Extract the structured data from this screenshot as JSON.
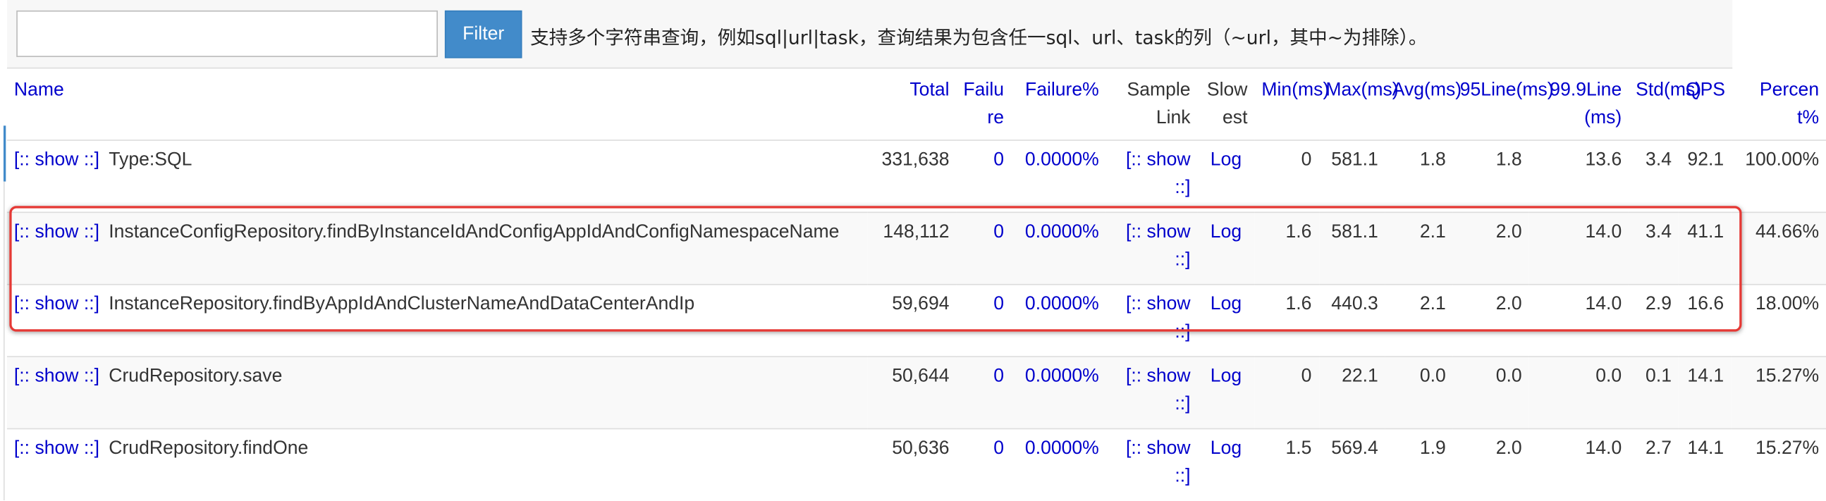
{
  "filter": {
    "input_value": "",
    "placeholder": "",
    "button_label": "Filter",
    "hint": "支持多个字符串查询，例如sql|url|task，查询结果为包含任一sql、url、task的列（~url，其中~为排除）。"
  },
  "headers": {
    "name": "Name",
    "total": "Total",
    "failure": "Failure",
    "failure_pct": "Failure%",
    "sample_link": "Sample Link",
    "slowest": "Slowest",
    "min": "Min(ms)",
    "max": "Max(ms)",
    "avg": "Avg(ms)",
    "line95": "95Line(ms)",
    "line999": "99.9Line(ms)",
    "std": "Std(ms)",
    "qps": "QPS",
    "percent": "Percent%"
  },
  "show_label": "[:: show ::]",
  "log_label": "Log",
  "rows": [
    {
      "name": "Type:SQL",
      "total": "331,638",
      "failure": "0",
      "failure_pct": "0.0000%",
      "min": "0",
      "max": "581.1",
      "avg": "1.8",
      "line95": "1.8",
      "line999": "13.6",
      "std": "3.4",
      "qps": "92.1",
      "percent": "100.00%"
    },
    {
      "name": "InstanceConfigRepository.findByInstanceIdAndConfigAppIdAndConfigNamespaceName",
      "total": "148,112",
      "failure": "0",
      "failure_pct": "0.0000%",
      "min": "1.6",
      "max": "581.1",
      "avg": "2.1",
      "line95": "2.0",
      "line999": "14.0",
      "std": "3.4",
      "qps": "41.1",
      "percent": "44.66%"
    },
    {
      "name": "InstanceRepository.findByAppIdAndClusterNameAndDataCenterAndIp",
      "total": "59,694",
      "failure": "0",
      "failure_pct": "0.0000%",
      "min": "1.6",
      "max": "440.3",
      "avg": "2.1",
      "line95": "2.0",
      "line999": "14.0",
      "std": "2.9",
      "qps": "16.6",
      "percent": "18.00%"
    },
    {
      "name": "CrudRepository.save",
      "total": "50,644",
      "failure": "0",
      "failure_pct": "0.0000%",
      "min": "0",
      "max": "22.1",
      "avg": "0.0",
      "line95": "0.0",
      "line999": "0.0",
      "std": "0.1",
      "qps": "14.1",
      "percent": "15.27%"
    },
    {
      "name": "CrudRepository.findOne",
      "total": "50,636",
      "failure": "0",
      "failure_pct": "0.0000%",
      "min": "1.5",
      "max": "569.4",
      "avg": "1.9",
      "line95": "2.0",
      "line999": "14.0",
      "std": "2.7",
      "qps": "14.1",
      "percent": "15.27%"
    }
  ],
  "colors": {
    "link": "#0000cc",
    "button": "#428bca",
    "highlight": "#e53935"
  }
}
